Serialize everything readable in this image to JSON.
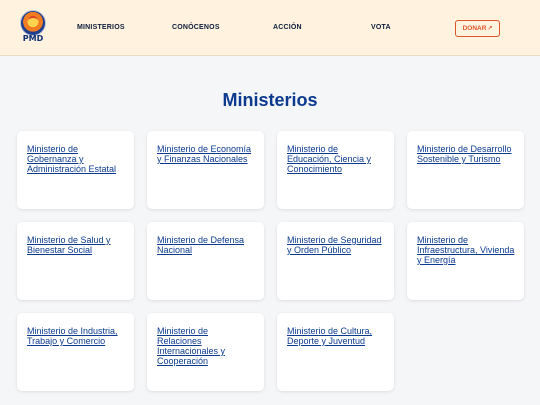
{
  "nav": {
    "logo_text": "PMD",
    "items": [
      "MINISTERIOS",
      "CONÓCENOS",
      "ACCIÓN",
      "VOTA"
    ],
    "donate_label": "DONAR",
    "donate_icon": "external-link-icon"
  },
  "main": {
    "title": "Ministerios",
    "ministries": [
      "Ministerio de Gobernanza y Administración Estatal",
      "Ministerio de Economía y Finanzas Nacionales",
      "Ministerio de Educación, Ciencia y Conocimiento",
      "Ministerio de Desarrollo Sostenible y Turismo",
      "Ministerio de Salud y Bienestar Social",
      "Ministerio de Defensa Nacional",
      "Ministerio de Seguridad y Orden Público",
      "Ministerio de Infraestructura, Vivienda y Energía",
      "Ministerio de Industria, Trabajo y Comercio",
      "Ministerio de Relaciones Internacionales y Cooperación",
      "Ministerio de Cultura, Deporte y Juventud"
    ]
  },
  "colors": {
    "header_bg": "#fff3e0",
    "primary": "#0b3a8f",
    "accent": "#e0552a"
  }
}
